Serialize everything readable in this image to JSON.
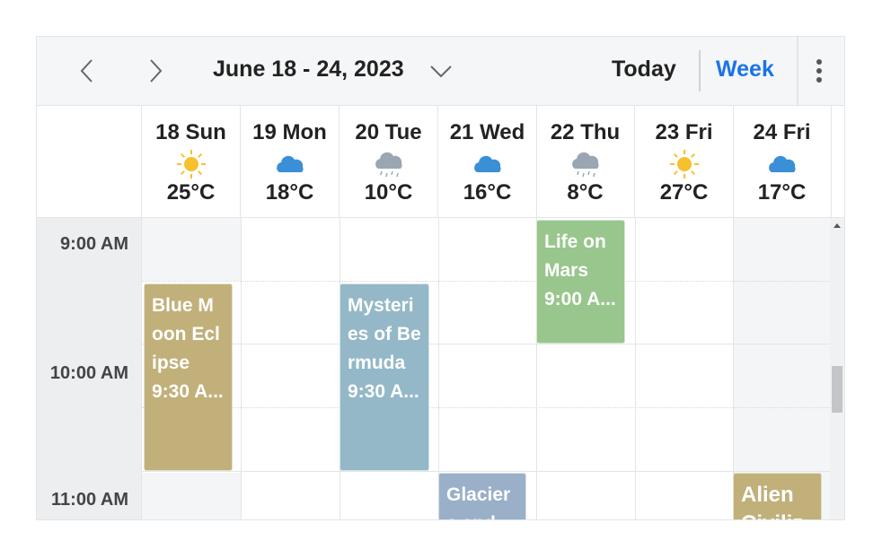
{
  "toolbar": {
    "prev_icon": "chevron-left-icon",
    "next_icon": "chevron-right-icon",
    "date_range": "June 18 - 24, 2023",
    "range_dropdown_icon": "chevron-down-icon",
    "today_label": "Today",
    "week_label": "Week",
    "more_icon": "more-vertical-icon",
    "active_view_color": "#1a73e8"
  },
  "days": [
    {
      "label": "18 Sun",
      "weather": "sunny",
      "temp": "25°C"
    },
    {
      "label": "19 Mon",
      "weather": "cloudy",
      "temp": "18°C"
    },
    {
      "label": "20 Tue",
      "weather": "rainy",
      "temp": "10°C"
    },
    {
      "label": "21 Wed",
      "weather": "cloudy",
      "temp": "16°C"
    },
    {
      "label": "22 Thu",
      "weather": "rainy",
      "temp": "8°C"
    },
    {
      "label": "23 Fri",
      "weather": "sunny",
      "temp": "27°C"
    },
    {
      "label": "24 Fri",
      "weather": "cloudy",
      "temp": "17°C"
    }
  ],
  "times": [
    "9:00 AM",
    "10:00 AM",
    "11:00 AM"
  ],
  "appointments": [
    {
      "title": "Blue Moon Eclipse",
      "time": "9:30 A...",
      "color": "#c1b07a"
    },
    {
      "title": "Mysteries of Bermuda",
      "time": "9:30 A...",
      "color": "#94b8c7"
    },
    {
      "title": "Life on Mars",
      "time": "9:00 A...",
      "color": "#98c68c"
    },
    {
      "title": "Glaciers and",
      "time": "",
      "color": "#9aafc8"
    },
    {
      "title": "Alien Civilizations",
      "time": "",
      "color": "#c1b07a"
    }
  ],
  "colors": {
    "sun": "#f6c02e",
    "cloud": "#3a8fd6",
    "rain_cloud": "#9aa6b1"
  }
}
